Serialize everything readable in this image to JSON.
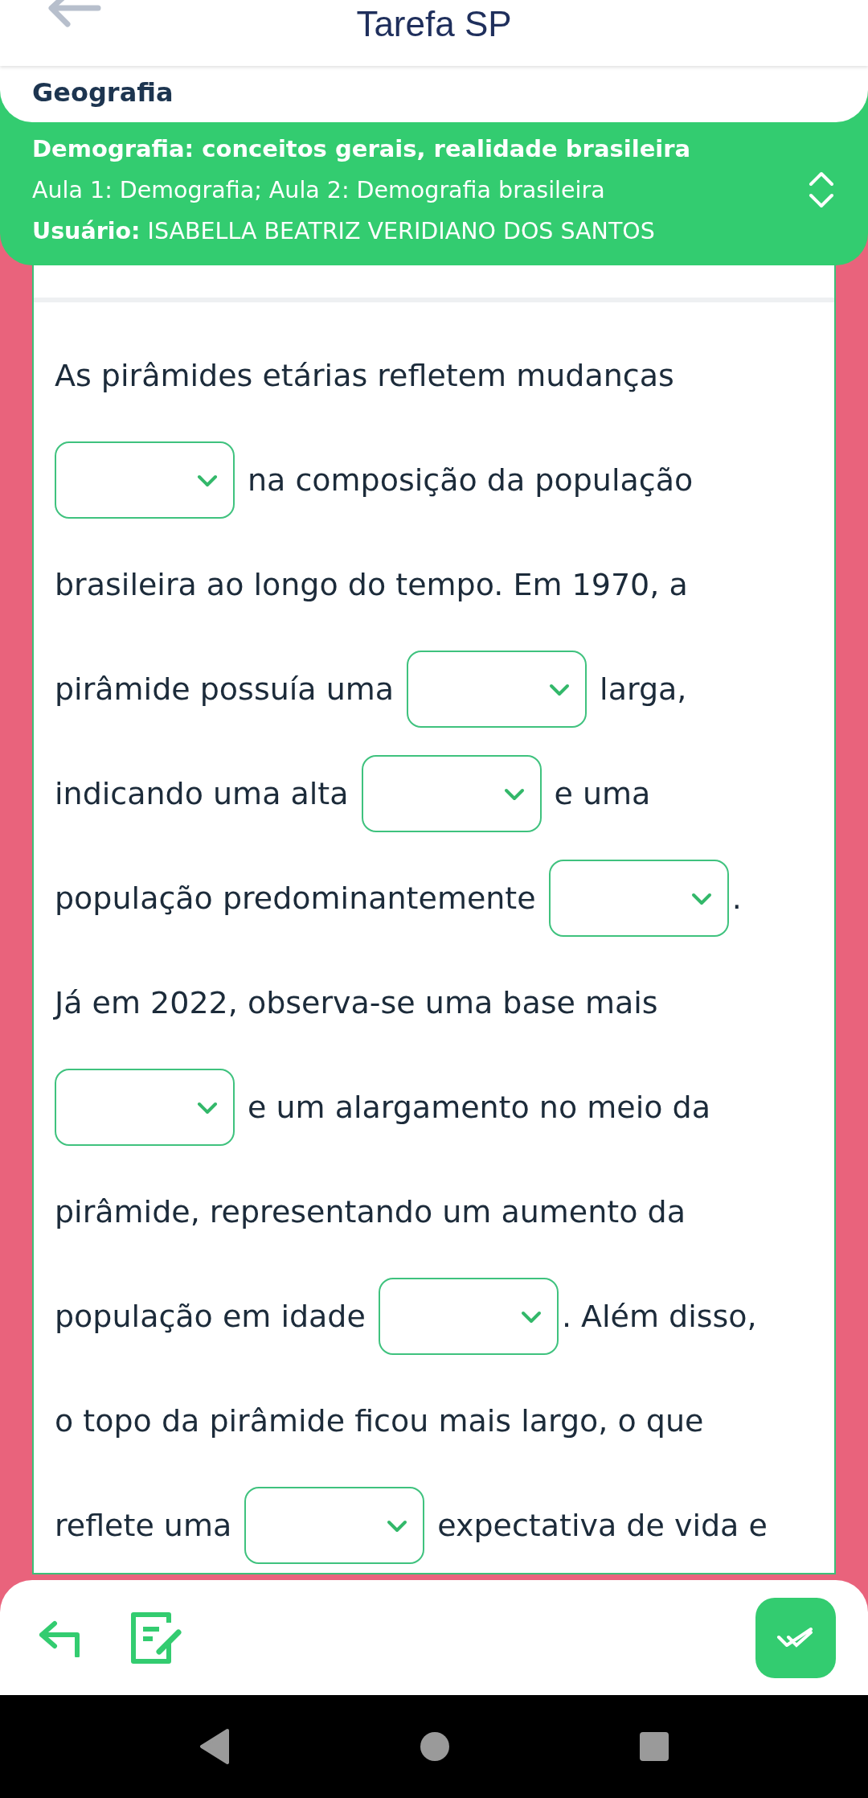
{
  "header": {
    "title": "Tarefa SP"
  },
  "subject": "Geografia",
  "info": {
    "topic": "Demografia: conceitos gerais, realidade brasileira",
    "lessons": "Aula 1: Demografia; Aula 2: Demografia brasileira",
    "user": "**Usuário:** ISABELLA BEATRIZ VERIDIANO DOS SANTOS"
  },
  "lines": [
    [
      {
        "kind": "text",
        "text": "As pirâmides etárias refletem mudanças"
      }
    ],
    [
      {
        "kind": "dropdown"
      },
      {
        "kind": "text",
        "text": "na composição da população"
      }
    ],
    [
      {
        "kind": "text",
        "text": "brasileira ao longo do tempo. Em 1970, a"
      }
    ],
    [
      {
        "kind": "text",
        "text": "pirâmide possuía uma"
      },
      {
        "kind": "dropdown"
      },
      {
        "kind": "text",
        "text": "larga,"
      }
    ],
    [
      {
        "kind": "text",
        "text": "indicando uma alta"
      },
      {
        "kind": "dropdown"
      },
      {
        "kind": "text",
        "text": "e uma"
      }
    ],
    [
      {
        "kind": "text",
        "text": "população predominantemente"
      },
      {
        "kind": "dropdown"
      },
      {
        "kind": "punct",
        "text": "."
      }
    ],
    [
      {
        "kind": "text",
        "text": "Já em 2022, observa-se uma base mais"
      }
    ],
    [
      {
        "kind": "dropdown"
      },
      {
        "kind": "text",
        "text": "e um alargamento no meio da"
      }
    ],
    [
      {
        "kind": "text",
        "text": "pirâmide, representando um aumento da"
      }
    ],
    [
      {
        "kind": "text",
        "text": "população em idade"
      },
      {
        "kind": "dropdown"
      },
      {
        "kind": "punct",
        "text": ". Além disso,"
      }
    ],
    [
      {
        "kind": "text",
        "text": "o topo da pirâmide ficou mais largo, o que"
      }
    ],
    [
      {
        "kind": "text",
        "text": "reflete uma"
      },
      {
        "kind": "dropdown"
      },
      {
        "kind": "text",
        "text": "expectativa de vida e"
      }
    ]
  ]
}
